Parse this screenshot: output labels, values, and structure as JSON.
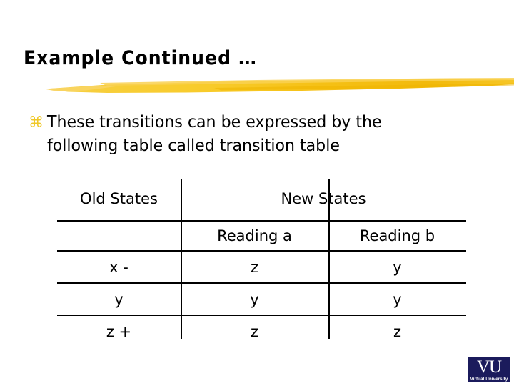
{
  "slide": {
    "title": "Example Continued …",
    "accent_color": "#F5C015",
    "text_color": "#000000",
    "background_color": "#FFFFFF"
  },
  "bullets": [
    {
      "glyph": "bullet-clover-icon",
      "glyph_char": "⌘",
      "line1": "These transitions can be expressed by the",
      "line2": "following table called transition table"
    }
  ],
  "table": {
    "group_headers": {
      "old": "Old States",
      "new": "New States"
    },
    "sub_headers": {
      "blank": "",
      "reading_a": "Reading a",
      "reading_b": "Reading b"
    },
    "rows": [
      {
        "old_state": "x -",
        "reading_a": "z",
        "reading_b": "y"
      },
      {
        "old_state": "y",
        "reading_a": "y",
        "reading_b": "y"
      },
      {
        "old_state": "z +",
        "reading_a": "z",
        "reading_b": "z"
      }
    ]
  },
  "logo": {
    "mark": "VU",
    "subtitle": "Virtual University",
    "box_color": "#1B1B5C"
  }
}
